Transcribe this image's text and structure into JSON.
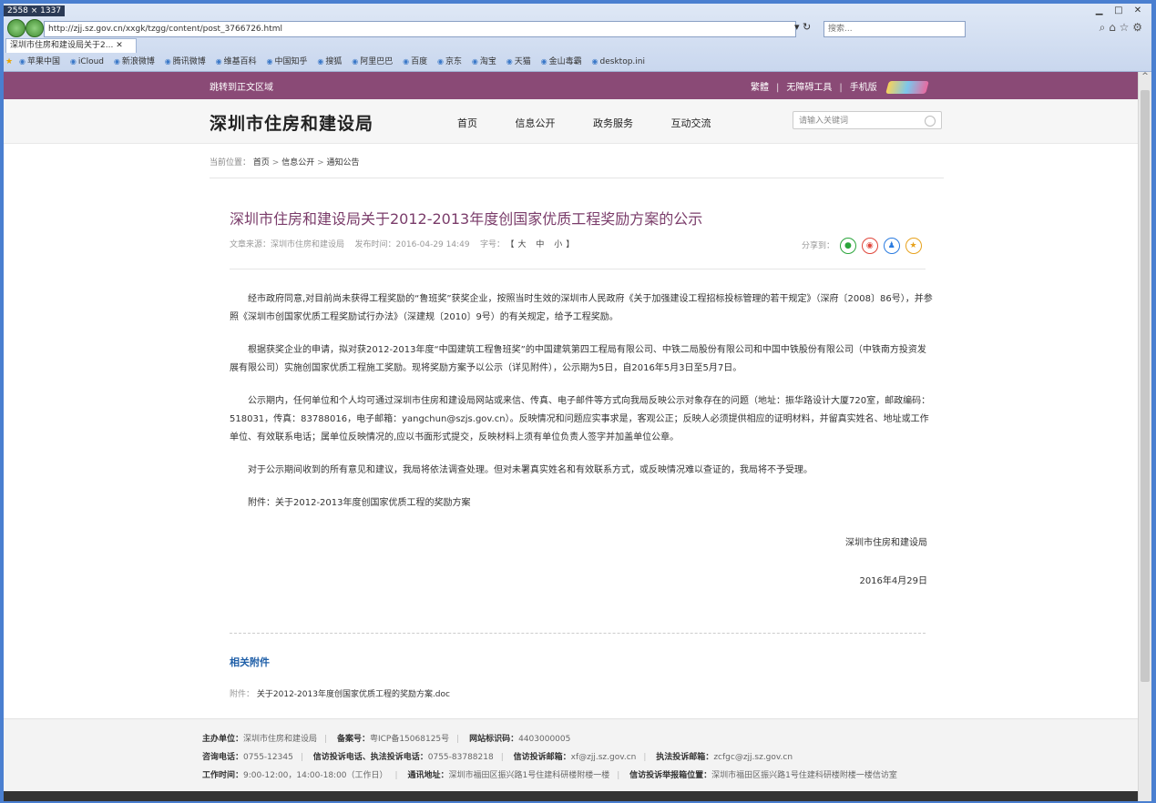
{
  "browser": {
    "dims": "2558 × 1337",
    "address": "http://zjj.sz.gov.cn/xxgk/tzgg/content/post_3766726.html",
    "search_placeholder": "搜索...",
    "tab_title": "深圳市住房和建设局关于2...",
    "bookmarks": [
      "苹果中国",
      "iCloud",
      "新浪微博",
      "腾讯微博",
      "维基百科",
      "中国知乎",
      "搜狐",
      "阿里巴巴",
      "百度",
      "京东",
      "淘宝",
      "天猫",
      "金山毒霸",
      "desktop.ini"
    ]
  },
  "topbar": {
    "skip": "跳转到正文区域",
    "traditional": "繁體",
    "accessibility": "无障碍工具",
    "mobile": "手机版"
  },
  "header": {
    "site_title": "深圳市住房和建设局",
    "nav": [
      "首页",
      "信息公开",
      "政务服务",
      "互动交流"
    ],
    "search_placeholder": "请输入关键词"
  },
  "breadcrumb": {
    "label": "当前位置：",
    "home": "首页",
    "sep": ">",
    "level1": "信息公开",
    "level2": "通知公告"
  },
  "article": {
    "title": "深圳市住房和建设局关于2012-2013年度创国家优质工程奖励方案的公示",
    "source": "文章来源：深圳市住房和建设局",
    "date": "发布时间：2016-04-29 14:49",
    "font_label": "字号：",
    "font_sizes": "【大 中 小】",
    "share_label": "分享到：",
    "paragraphs": [
      "经市政府同意,对目前尚未获得工程奖励的“鲁班奖”获奖企业，按照当时生效的深圳市人民政府《关于加强建设工程招标投标管理的若干规定》（深府〔2008〕86号），并参照《深圳市创国家优质工程奖励试行办法》（深建规〔2010〕9号）的有关规定，给予工程奖励。",
      "根据获奖企业的申请，拟对获2012-2013年度“中国建筑工程鲁班奖”的中国建筑第四工程局有限公司、中铁二局股份有限公司和中国中铁股份有限公司（中铁南方投资发展有限公司）实施创国家优质工程施工奖励。现将奖励方案予以公示（详见附件），公示期为5日，自2016年5月3日至5月7日。",
      "公示期内，任何单位和个人均可通过深圳市住房和建设局网站或来信、传真、电子邮件等方式向我局反映公示对象存在的问题（地址：振华路设计大厦720室，邮政编码：518031，传真：83788016，电子邮箱：yangchun@szjs.gov.cn）。反映情况和问题应实事求是，客观公正；反映人必须提供相应的证明材料，并留真实姓名、地址或工作单位、有效联系电话；属单位反映情况的,应以书面形式提交，反映材料上须有单位负责人签字并加盖单位公章。",
      "对于公示期间收到的所有意见和建议，我局将依法调查处理。但对未署真实姓名和有效联系方式，或反映情况难以查证的，我局将不予受理。",
      "附件：关于2012-2013年度创国家优质工程的奖励方案"
    ],
    "signature": "深圳市住房和建设局",
    "sign_date": "2016年4月29日",
    "related_title": "相关附件",
    "attachment_label": "附件：",
    "attachment_link": "关于2012-2013年度创国家优质工程的奖励方案.doc"
  },
  "footer": {
    "host_label": "主办单位：",
    "host": "深圳市住房和建设局",
    "icp_label": "备案号：",
    "icp": "粤ICP备15068125号",
    "site_id_label": "网站标识码：",
    "site_id": "4403000005",
    "consult_label": "咨询电话：",
    "consult": "0755-12345",
    "complaint_phone_label": "信访投诉电话、执法投诉电话：",
    "complaint_phone": "0755-83788218",
    "complaint_mail_label": "信访投诉邮箱：",
    "complaint_mail": "xf@zjj.sz.gov.cn",
    "enforce_mail_label": "执法投诉邮箱：",
    "enforce_mail": "zcfgc@zjj.sz.gov.cn",
    "hours_label": "工作时间：",
    "hours": "9:00-12:00，14:00-18:00（工作日）",
    "address_label": "通讯地址：",
    "address": "深圳市福田区振兴路1号住建科研楼附楼一楼",
    "report_label": "信访投诉举报箱位置：",
    "report": "深圳市福田区振兴路1号住建科研楼附楼一楼信访室"
  },
  "colors": {
    "brand_purple": "#8a4a76",
    "title_purple": "#7a3c6a",
    "link_blue": "#1f5fa8"
  }
}
